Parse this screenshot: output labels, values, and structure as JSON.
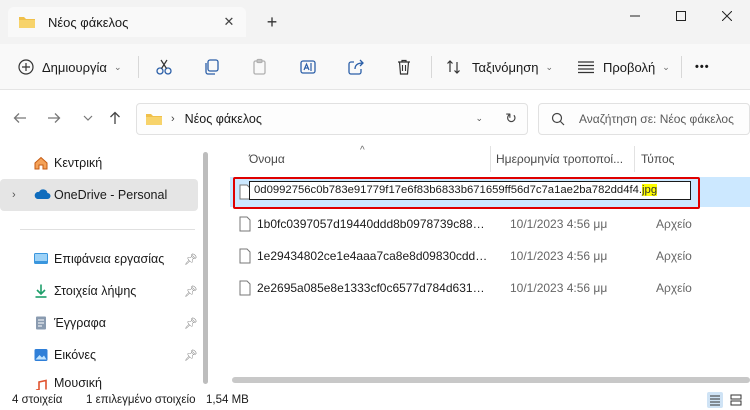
{
  "window": {
    "tab_title": "Νέος φάκελος",
    "tab_close": "✕",
    "new_tab": "+"
  },
  "toolbar": {
    "new_label": "Δημιουργία",
    "sort_label": "Ταξινόμηση",
    "view_label": "Προβολή",
    "more": "•••"
  },
  "address": {
    "crumb": "Νέος φάκελος",
    "search_placeholder": "Αναζήτηση σε: Νέος φάκελος"
  },
  "sidebar": {
    "items": [
      {
        "label": "Κεντρική",
        "icon": "home-icon"
      },
      {
        "label": "OneDrive - Personal",
        "icon": "onedrive-cloud-icon"
      },
      {
        "label": "Επιφάνεια εργασίας",
        "icon": "desktop-icon"
      },
      {
        "label": "Στοιχεία λήψης",
        "icon": "download-icon"
      },
      {
        "label": "Έγγραφα",
        "icon": "documents-icon"
      },
      {
        "label": "Εικόνες",
        "icon": "pictures-icon"
      },
      {
        "label": "Μουσική",
        "icon": "music-icon"
      }
    ]
  },
  "columns": {
    "name": "Όνομα",
    "date": "Ημερομηνία τροποποί...",
    "type": "Τύπος"
  },
  "files": [
    {
      "name_base": "0d0992756c0b783e91779f17e6f83b6833b671659ff56d7c7a1ae2ba782dd4f4.",
      "name_ext": "jpg",
      "date": "",
      "type": ""
    },
    {
      "name": "1b0fc0397057d19440ddd8b0978739c8877...",
      "date": "10/1/2023 4:56 μμ",
      "type": "Αρχείο"
    },
    {
      "name": "1e29434802ce1e4aaa7ca8e8d09830cdd33...",
      "date": "10/1/2023 4:56 μμ",
      "type": "Αρχείο"
    },
    {
      "name": "2e2695a085e8e1333cf0c6577d784d631b0a...",
      "date": "10/1/2023 4:56 μμ",
      "type": "Αρχείο"
    }
  ],
  "status": {
    "count": "4 στοιχεία",
    "selected": "1 επιλεγμένο στοιχείο",
    "size": "1,54 MB"
  },
  "colors": {
    "selection": "#cce8ff",
    "highlight_box": "#e00000",
    "folder": "#f0c04a",
    "onedrive": "#0f6cbd"
  }
}
